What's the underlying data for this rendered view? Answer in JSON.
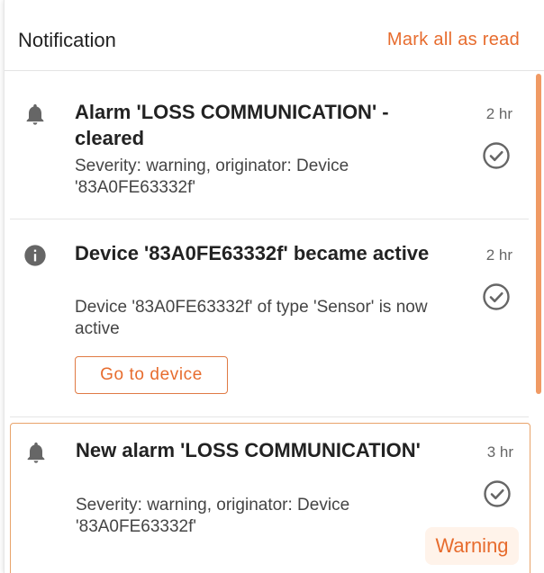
{
  "header": {
    "title": "Notification",
    "mark_all_label": "Mark all as read"
  },
  "notifications": [
    {
      "icon": "bell-icon",
      "title": "Alarm 'LOSS COMMUNICATION' - cleared",
      "description": "Severity: warning, originator: Device '83A0FE63332f'",
      "time": "2 hr"
    },
    {
      "icon": "info-icon",
      "title": "Device '83A0FE63332f' became active",
      "description": "Device '83A0FE63332f' of type 'Sensor' is now active",
      "time": "2 hr",
      "action_label": "Go to device"
    },
    {
      "icon": "bell-icon",
      "title": "New alarm 'LOSS COMMUNICATION'",
      "description": "Severity: warning, originator: Device '83A0FE63332f'",
      "time": "3 hr",
      "badge": "Warning"
    }
  ],
  "colors": {
    "accent": "#e76c2e",
    "highlight_border": "#e8a36a",
    "badge_background": "#fff3ea",
    "icon_gray": "#666666"
  }
}
